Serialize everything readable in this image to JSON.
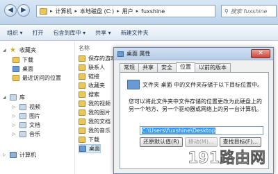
{
  "address_bar": {
    "segments": [
      "计算机",
      "本地磁盘 (C:)",
      "用户",
      "fuxshine"
    ],
    "search_placeholder": "搜索 fuxshine"
  },
  "toolbar": {
    "organize_label": "组织 ▾",
    "open_label": "打开",
    "include_label": "包含到库中 ▾",
    "share_label": "共享 ▾",
    "new_folder_label": "新建文件夹"
  },
  "sidebar": {
    "favorites": "收藏夹",
    "downloads": "下载",
    "desktop": "桌面",
    "recent": "最近访问的位置",
    "libraries": "库",
    "videos": "视频",
    "pictures": "图片",
    "documents": "文档",
    "music": "音乐",
    "computer": "计算机"
  },
  "filelist": {
    "header": "名称",
    "items": [
      "保存的游戏",
      "联系人",
      "链接",
      "收藏夹",
      "搜索",
      "我的视频",
      "我的图片",
      "我的文档",
      "我的音乐",
      "下载",
      "桌面"
    ]
  },
  "dialog": {
    "title": "桌面 属性",
    "close": "✕",
    "tabs": [
      "常规",
      "共享",
      "安全",
      "位置",
      "以前的版本"
    ],
    "active_tab": "位置",
    "description_line1": "文件夹 桌面 中的文件夹存储于以下目标位置中。",
    "description": "您可以将此文件夹中文件存储的位置更改为此硬盘上的另一个地方、另一个驱动器或网络上的另一台计算机。",
    "path_value": "C:\\Users\\fuxshine\\Desktop",
    "buttons": {
      "restore": "还原默认值(R)",
      "move": "移动(M)...",
      "find_target": "查找目标(F)..."
    }
  },
  "watermark": {
    "num": "191",
    "text": "路由网"
  }
}
